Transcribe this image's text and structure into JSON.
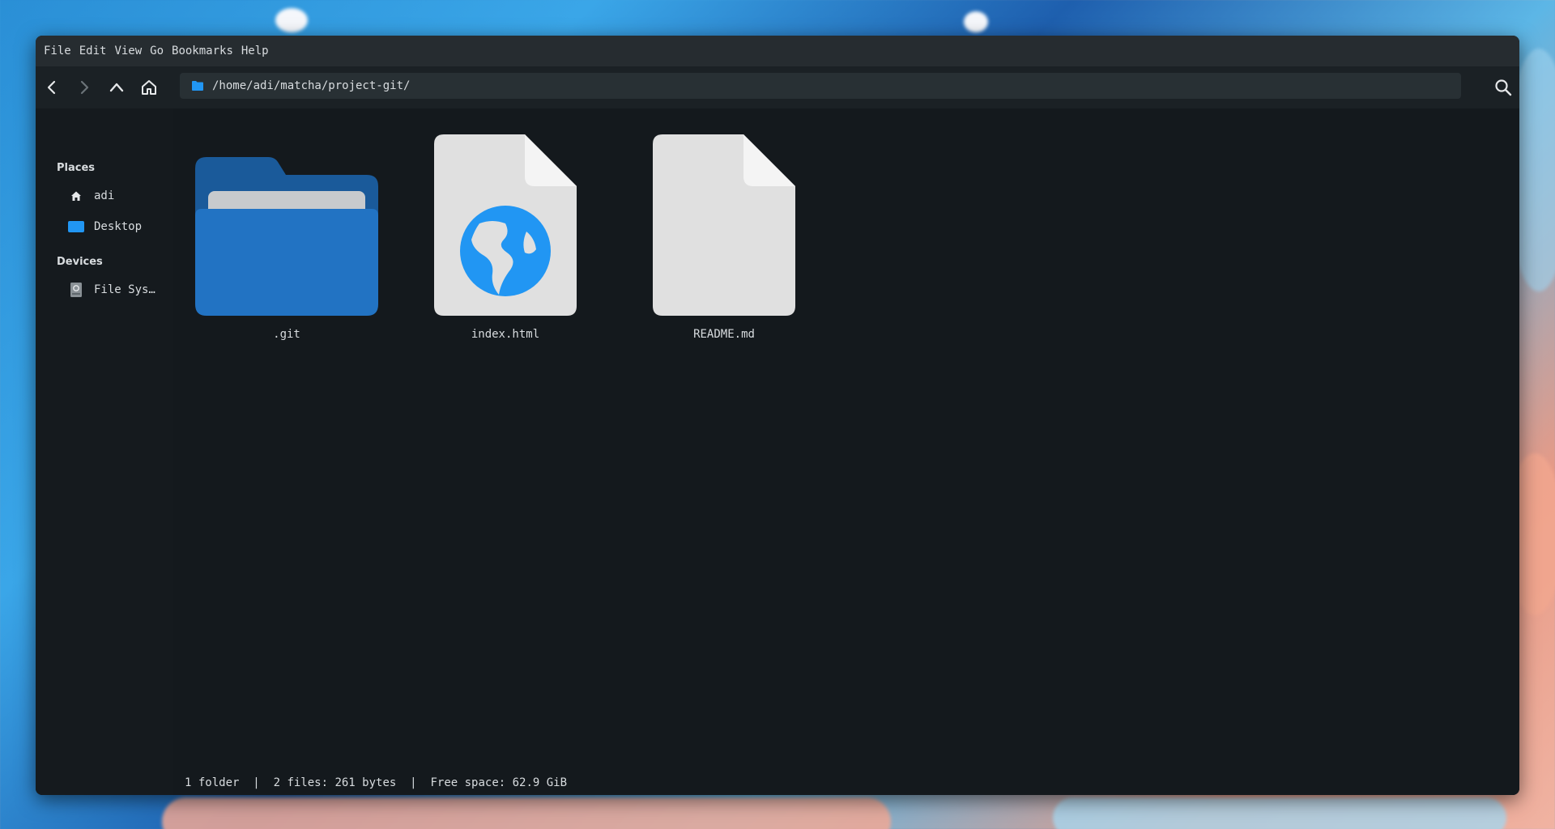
{
  "menu": {
    "items": [
      "File",
      "Edit",
      "View",
      "Go",
      "Bookmarks",
      "Help"
    ]
  },
  "toolbar": {
    "path": "/home/adi/matcha/project-git/",
    "back_icon": "chevron-left-icon",
    "forward_icon": "chevron-right-icon",
    "up_icon": "chevron-up-icon",
    "home_icon": "home-icon",
    "search_icon": "search-icon"
  },
  "sidebar": {
    "places_heading": "Places",
    "places": [
      {
        "label": "adi",
        "icon": "home-icon"
      },
      {
        "label": "Desktop",
        "icon": "desktop-folder-icon"
      }
    ],
    "devices_heading": "Devices",
    "devices": [
      {
        "label": "File Sys…",
        "icon": "drive-icon"
      }
    ]
  },
  "files": [
    {
      "name": ".git",
      "icon": "folder-icon"
    },
    {
      "name": "index.html",
      "icon": "html-file-icon"
    },
    {
      "name": "README.md",
      "icon": "text-file-icon"
    }
  ],
  "status": {
    "folders": "1 folder",
    "files": "2 files: 261 bytes",
    "free_space": "Free space: 62.9 GiB",
    "separator": "|"
  },
  "colors": {
    "accent": "#2196f3",
    "folder_front": "#2273c3",
    "folder_back": "#1a5a9a",
    "window_bg": "#14191d",
    "menubar_bg": "#262c30"
  }
}
